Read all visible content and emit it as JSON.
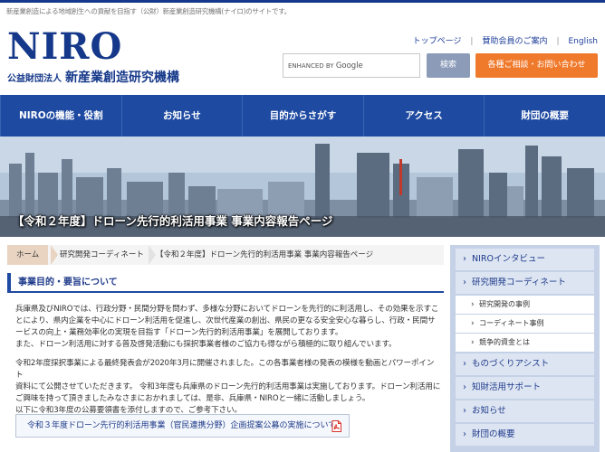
{
  "topbar": {
    "text": "新産業創造による地域創生への貢献を目指す（公財）新産業創造研究機構(ナイロ)のサイトです。"
  },
  "logo": {
    "main": "NIRO",
    "sub_prefix": "公益財団法人",
    "sub_name": "新産業創造研究機構"
  },
  "header_links": [
    "トップページ",
    "賛助会員のご案内",
    "English"
  ],
  "search": {
    "brand_prefix": "ENHANCED BY",
    "brand_name": "Google",
    "button_label": "検索"
  },
  "consult_button": "各種ご相談・お問い合わせ",
  "global_nav": [
    "NIROの機能・役割",
    "お知らせ",
    "目的からさがす",
    "アクセス",
    "財団の概要"
  ],
  "hero": {
    "title": "【令和２年度】ドローン先行的利活用事業 事業内容報告ページ"
  },
  "breadcrumb": [
    "ホーム",
    "研究開発コーディネート",
    "【令和２年度】ドローン先行的利活用事業 事業内容報告ページ"
  ],
  "section": {
    "heading": "事業目的・要旨について"
  },
  "paragraph1": [
    "兵庫県及びNIROでは、行政分野・民間分野を問わず、多様な分野においてドローンを先行的に利活用し、その効果を示すこ",
    "とにより、県内企業を中心にドローン利活用を促進し、次世代産業の創出、県民の更なる安全安心な暮らし、行政・民間サ",
    "ービスの向上・業務効率化の実現を目指す「ドローン先行的利活用事業」を展開しております。",
    "また、ドローン利活用に対する普及啓発活動にも採択事業者様のご協力も得ながら積極的に取り組んでいます。"
  ],
  "paragraph2": [
    "令和2年度採択事業による最終発表会が2020年3月に開催されました。この各事業者様の発表の模様を動画とパワーポイント",
    "資料にて公開させていただきます。 令和3年度も兵庫県のドローン先行的利活用事業は実施しております。ドローン利活用に",
    "ご興味を持って頂きましたみなさまにおかれましては、是非、兵庫県・NIROと一緒に活動しましょう。",
    "以下に令和3年度の公募要領書を添付しますので、ご参考下さい。"
  ],
  "announcement": "令和３年度ドローン先行的利活用事業（官民連携分野）企画提案公募の実施について",
  "sidebar": {
    "items": [
      "NIROインタビュー",
      "研究開発コーディネート",
      "ものづくりアシスト",
      "知財活用サポート",
      "お知らせ",
      "財団の概要"
    ],
    "sub_items": [
      "研究開発の事例",
      "コーディネート事例",
      "競争的資金とは"
    ]
  },
  "colors": {
    "brand_navy": "#15388a",
    "nav_blue": "#1e4aa1",
    "accent_orange": "#f07a2c",
    "search_button": "#8b9bb8",
    "sidebar_bg": "#c4d1e6"
  },
  "icons": [
    "pdf-icon"
  ]
}
